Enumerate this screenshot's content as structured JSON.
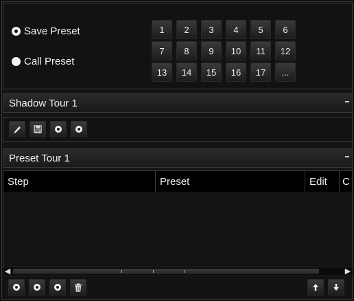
{
  "preset": {
    "save_label": "Save Preset",
    "call_label": "Call Preset",
    "numbers": [
      "1",
      "2",
      "3",
      "4",
      "5",
      "6",
      "7",
      "8",
      "9",
      "10",
      "11",
      "12",
      "13",
      "14",
      "15",
      "16",
      "17",
      "..."
    ]
  },
  "shadow_tour": {
    "title": "Shadow Tour 1",
    "tools": [
      "pencil-icon",
      "save-icon",
      "record-start-icon",
      "record-stop-icon"
    ]
  },
  "preset_tour": {
    "title": "Preset Tour 1",
    "columns": [
      "Step",
      "Preset",
      "Edit",
      "C"
    ]
  },
  "bottom_tools": [
    "add-icon",
    "clear-icon",
    "call-icon",
    "delete-icon",
    "up-arrow-icon",
    "down-arrow-icon"
  ],
  "colors": {
    "background": "#0d0d0d",
    "panel": "#141414",
    "header": "#000000",
    "text": "#f0f0f0"
  }
}
